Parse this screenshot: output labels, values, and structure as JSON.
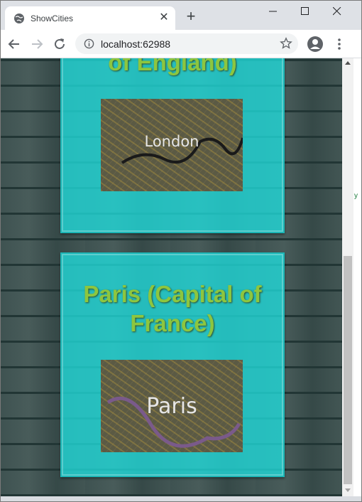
{
  "browser": {
    "tab_title": "ShowCities",
    "url": "localhost:62988",
    "new_tab_symbol": "+",
    "tab_close_symbol": "✕"
  },
  "page": {
    "cards": [
      {
        "title": "of England)",
        "map_label": "London"
      },
      {
        "title": "Paris (Capital of France)",
        "map_label": "Paris"
      }
    ],
    "side_fragment": "y"
  },
  "colors": {
    "card_bg": "#20dcdc",
    "title_color": "#8dc63f"
  }
}
